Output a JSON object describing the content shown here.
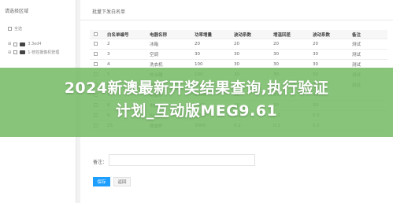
{
  "left_panel": {
    "title": "请选择区域",
    "root_label": "全选",
    "nodes": [
      {
        "label": "3.3ed4"
      },
      {
        "label": "1-管控摄像机管理"
      }
    ]
  },
  "main": {
    "title": "批量下发白名单",
    "table": {
      "headers": [
        "白名单编号",
        "电器名称",
        "功率增量",
        "波动系数",
        "增温回差",
        "波动系数",
        "备注"
      ],
      "rows": [
        [
          "2",
          "冰箱",
          "20",
          "20",
          "20",
          "20",
          "测试"
        ],
        [
          "3",
          "空调",
          "30",
          "30",
          "30",
          "30",
          "测试"
        ],
        [
          "4",
          "洗衣机",
          "100",
          "30",
          "30",
          "30",
          "测试"
        ],
        [
          "5",
          "热水器",
          "100",
          "30",
          "30",
          "30",
          "测试"
        ],
        [
          "6",
          "电饭煲",
          "200",
          "30",
          "30",
          "30",
          "测试"
        ],
        [
          "7",
          "电磁炉",
          "2000",
          "30",
          "30",
          "30",
          ""
        ],
        [
          "8",
          "电视机",
          "2000",
          "30",
          "30",
          "30",
          ""
        ],
        [
          "9",
          "吸尘器",
          "2000",
          "0.2",
          "0.2",
          "0.2",
          ""
        ],
        [
          "25",
          "微波炉",
          "2000",
          "0.2",
          "0.2",
          "0.2",
          ""
        ]
      ]
    },
    "remark_label": "备注：",
    "remark_value": "",
    "save_label": "保存",
    "back_label": "返回"
  },
  "banner": {
    "line1": "2024新澳最新开奖结果查询,执行验证",
    "line2": "计划_互动版MEG9.61"
  }
}
